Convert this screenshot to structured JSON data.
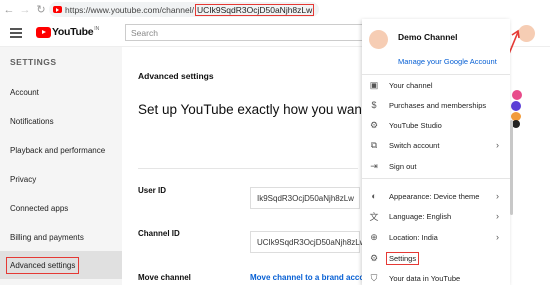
{
  "browser": {
    "url_prefix": "https://www.youtube.com/channel/",
    "url_channel": "UCIk9SqdR3OcjD50aNjh8zLw"
  },
  "header": {
    "logo_text": "YouTube",
    "logo_country": "IN",
    "search_placeholder": "Search"
  },
  "sidebar": {
    "title": "SETTINGS",
    "items": [
      {
        "label": "Account"
      },
      {
        "label": "Notifications"
      },
      {
        "label": "Playback and performance"
      },
      {
        "label": "Privacy"
      },
      {
        "label": "Connected apps"
      },
      {
        "label": "Billing and payments"
      },
      {
        "label": "Advanced settings",
        "active": true
      }
    ]
  },
  "main": {
    "heading": "Advanced settings",
    "title": "Set up YouTube exactly how you want it",
    "user_id_label": "User ID",
    "user_id_value": "Ik9SqdR3OcjD50aNjh8zLw",
    "channel_id_label": "Channel ID",
    "channel_id_value": "UCIk9SqdR3OcjD50aNjh8zLw",
    "move_channel_label": "Move channel",
    "move_channel_link": "Move channel to a brand account"
  },
  "menu": {
    "name": "Demo Channel",
    "manage_link": "Manage your Google Account",
    "items": [
      {
        "label": "Your channel",
        "icon": "person-icon"
      },
      {
        "label": "Purchases and memberships",
        "icon": "dollar-icon"
      },
      {
        "label": "YouTube Studio",
        "icon": "gear-icon"
      },
      {
        "label": "Switch account",
        "icon": "switch-account-icon",
        "chevron": true
      },
      {
        "label": "Sign out",
        "icon": "sign-out-icon"
      },
      {
        "label": "Appearance: Device theme",
        "icon": "appearance-icon",
        "chevron": true
      },
      {
        "label": "Language: English",
        "icon": "translate-icon",
        "chevron": true
      },
      {
        "label": "Location: India",
        "icon": "globe-icon",
        "chevron": true
      },
      {
        "label": "Settings",
        "icon": "gear-icon",
        "highlighted": true
      },
      {
        "label": "Your data in YouTube",
        "icon": "shield-icon"
      }
    ]
  },
  "colors": {
    "accent_red": "#e53935",
    "link_blue": "#065fd4",
    "youtube_red": "#ff0000"
  }
}
